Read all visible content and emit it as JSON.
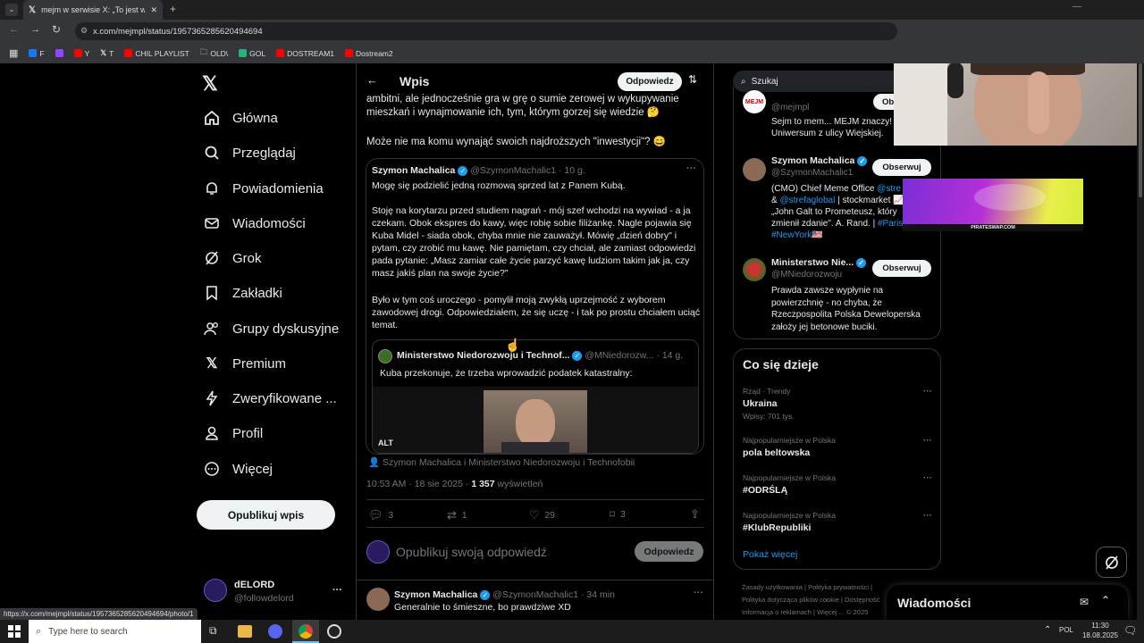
{
  "browser": {
    "tab_title": "mejm w serwisie X: „To jest w s...",
    "url": "x.com/mejmpl/status/1957365285620494694",
    "status_url": "https://x.com/mejmpl/status/1957365285620494694/photo/1",
    "bookmarks": [
      "F",
      "Y",
      "T",
      "CHIL PLAYLIST",
      "OLD\\",
      "GOL",
      "DOSTREAM1",
      "Dostream2"
    ]
  },
  "sidebar": {
    "items": [
      {
        "label": "Główna",
        "icon": "home-icon"
      },
      {
        "label": "Przeglądaj",
        "icon": "search-icon"
      },
      {
        "label": "Powiadomienia",
        "icon": "bell-icon"
      },
      {
        "label": "Wiadomości",
        "icon": "mail-icon"
      },
      {
        "label": "Grok",
        "icon": "grok-icon"
      },
      {
        "label": "Zakładki",
        "icon": "bookmark-icon"
      },
      {
        "label": "Grupy dyskusyjne",
        "icon": "people-icon"
      },
      {
        "label": "Premium",
        "icon": "x-icon"
      },
      {
        "label": "Zweryfikowane ...",
        "icon": "lightning-icon"
      },
      {
        "label": "Profil",
        "icon": "person-icon"
      },
      {
        "label": "Więcej",
        "icon": "more-circle-icon"
      }
    ],
    "post_button": "Opublikuj wpis",
    "account_name": "dELORD",
    "account_handle": "@followdelord"
  },
  "header": {
    "title": "Wpis",
    "reply_button": "Odpowiedz"
  },
  "post": {
    "text_top": "ambitni, ale jednocześnie gra w grę o sumie zerowej w wykupywanie mieszkań i wynajmowanie ich, tym, którym gorzej się wiedzie 🤔",
    "text_question": "Może nie ma komu wynająć swoich najdroższych \"inwestycji\"? 😄",
    "quote": {
      "name": "Szymon Machalica",
      "handle": "@SzymonMachalic1 · 10 g.",
      "p1": "Mogę się podzielić jedną rozmową sprzed lat z Panem Kubą.",
      "p2": "Stoję na korytarzu przed studiem nagrań - mój szef wchodzi na wywiad - a ja czekam. Obok ekspres do kawy, więc robię sobie filiżankę. Nagle pojawia się Kuba Midel - siada obok, chyba mnie nie zauważył. Mówię „dzień dobry\" i pytam, czy zrobić mu kawę. Nie pamiętam, czy chciał, ale zamiast odpowiedzi pada pytanie: „Masz zamiar całe życie parzyć kawę ludziom takim jak ja, czy masz jakiś plan na swoje życie?\"",
      "p3": "Było w tym coś uroczego - pomylił moją zwykłą uprzejmość z wyborem zawodowej drogi. Odpowiedziałem, że się uczę - i tak po prostu chciałem uciąć temat.",
      "nested": {
        "name": "Ministerstwo Niedorozwoju i Technof...",
        "handle": "@MNiedorozw... · 14 g.",
        "text": "Kuba przekonuje, że trzeba wprowadzić podatek katastralny:",
        "alt": "ALT"
      }
    },
    "tagged": "Szymon Machalica i Ministerstwo Niedorozwoju i Technofobii",
    "time": "10:53 AM · 18 sie 2025 · ",
    "views_count": "1 357",
    "views_label": " wyświetleń",
    "stats": {
      "replies": "3",
      "reposts": "1",
      "likes": "29",
      "bookmarks": "3"
    },
    "reply_placeholder": "Opublikuj swoją odpowiedź",
    "reply_button": "Odpowiedz"
  },
  "reply": {
    "name": "Szymon Machalica",
    "handle": "@SzymonMachalic1 · 34 min",
    "text": "Generalnie to śmieszne, bo prawdziwe XD"
  },
  "right": {
    "search_placeholder": "Szukaj",
    "follow_label": "Obserwuj",
    "accounts": [
      {
        "handle": "@mejmpl",
        "bio": "Sejm to mem... MEJM znaczy! Uniwersum z ulicy Wiejskiej."
      },
      {
        "name": "Szymon Machalica",
        "handle": "@SzymonMachalic1",
        "bio_a": "(CMO) Chief Meme Office ",
        "bio_b": "@stre",
        "bio_c": "& ",
        "bio_d": "@strefaglobal",
        "bio_e": " | stockmarket 📈 „John Galt to Prometeusz, który zmienił zdanie\". A. Rand. | ",
        "bio_f": "#Paris",
        "bio_g": "#NewYork",
        "bio_h": "🇺🇸"
      },
      {
        "name": "Ministerstwo Nie...",
        "handle": "@MNiedorozwoju",
        "bio": "Prawda zawsze wypłynie na powierzchnię - no chyba, że Rzeczpospolita Polska Deweloperska założy jej betonowe buciki."
      }
    ],
    "trends_title": "Co się dzieje",
    "trends": [
      {
        "meta": "Rząd · Trendy",
        "name": "Ukraina",
        "count": "Wpisy: 701 tys."
      },
      {
        "meta": "Najpopularniejsze w Polska",
        "name": "pola beltowska",
        "count": ""
      },
      {
        "meta": "Najpopularniejsze w Polska",
        "name": "#ODRŚLĄ",
        "count": ""
      },
      {
        "meta": "Najpopularniejsze w Polska",
        "name": "#KlubRepubliki",
        "count": ""
      }
    ],
    "show_more": "Pokaż więcej",
    "footer_links": [
      "Zasady użytkowania",
      "Polityka prywatności",
      "Polityka dotycząca plików cookie",
      "Dostępność",
      "Informacja o reklamach",
      "Więcej ...",
      "© 2025"
    ],
    "messages_title": "Wiadomości",
    "banner_text": "PIRATESWAP.COM"
  },
  "taskbar": {
    "search_placeholder": "Type here to search",
    "lang": "POL",
    "time": "11:30",
    "date": "18.08.2025"
  }
}
